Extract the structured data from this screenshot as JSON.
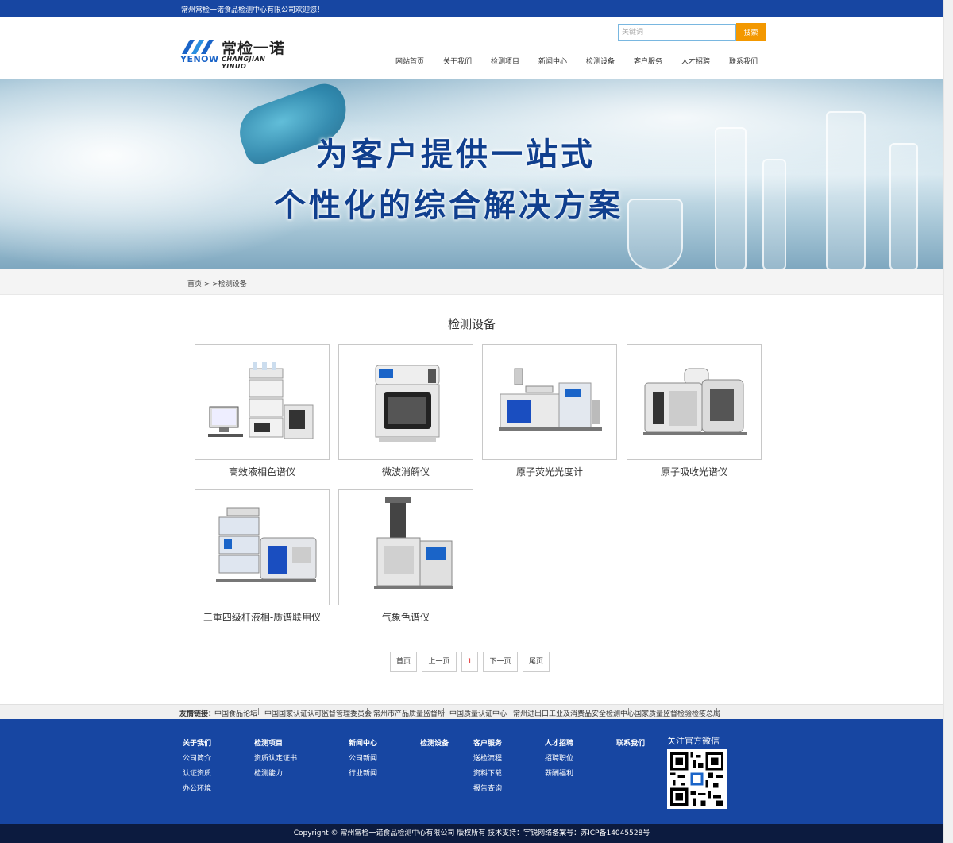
{
  "topbar": {
    "welcome": "常州常检一诺食品检测中心有限公司欢迎您！"
  },
  "logo": {
    "brand_en": "YENOW",
    "brand_cn": "常检一诺",
    "brand_pinyin": "CHANGJIAN YINUO"
  },
  "search": {
    "placeholder": "关键词",
    "button": "搜索"
  },
  "nav": [
    {
      "label": "网站首页"
    },
    {
      "label": "关于我们"
    },
    {
      "label": "检测项目"
    },
    {
      "label": "新闻中心"
    },
    {
      "label": "检测设备"
    },
    {
      "label": "客户服务"
    },
    {
      "label": "人才招聘"
    },
    {
      "label": "联系我们"
    }
  ],
  "banner": {
    "line1": "为客户提供一站式",
    "line2": "个性化的综合解决方案"
  },
  "breadcrumb": "首页 > >检测设备",
  "section_title": "检测设备",
  "products": [
    {
      "name": "高效液相色谱仪",
      "icon": "hplc-instrument-image"
    },
    {
      "name": "微波消解仪",
      "icon": "microwave-digester-image"
    },
    {
      "name": "原子荧光光度计",
      "icon": "atomic-fluorescence-image"
    },
    {
      "name": "原子吸收光谱仪",
      "icon": "atomic-absorption-image"
    },
    {
      "name": "三重四级杆液相-质谱联用仪",
      "icon": "lc-ms-image"
    },
    {
      "name": "气象色谱仪",
      "icon": "gas-chromatograph-image"
    }
  ],
  "pagination": {
    "first": "首页",
    "prev": "上一页",
    "current": "1",
    "next": "下一页",
    "last": "尾页"
  },
  "friend_links": {
    "label": "友情链接：",
    "items": [
      "中国食品论坛",
      "中国国家认证认可监督管理委员会",
      "常州市产品质量监督所",
      "中国质量认证中心",
      "常州进出口工业及消费品安全检测中心",
      "国家质量监督检验检疫总局"
    ]
  },
  "footer": {
    "columns": [
      {
        "title": "关于我们",
        "items": [
          "公司简介",
          "认证资质",
          "办公环境"
        ]
      },
      {
        "title": "检测项目",
        "items": [
          "资质认定证书",
          "检测能力"
        ]
      },
      {
        "title": "新闻中心",
        "items": [
          "公司新闻",
          "行业新闻"
        ]
      },
      {
        "title": "检测设备",
        "items": []
      },
      {
        "title": "客户服务",
        "items": [
          "送检流程",
          "资料下载",
          "报告查询"
        ]
      },
      {
        "title": "人才招聘",
        "items": [
          "招聘职位",
          "薪酬福利"
        ]
      },
      {
        "title": "联系我们",
        "items": []
      }
    ],
    "wechat_title": "关注官方微信"
  },
  "copyright": "Copyright © 常州常检一诺食品检测中心有限公司 版权所有 技术支持：宇锐网络备案号：苏ICP备14045528号",
  "colors": {
    "primary_blue": "#1746a2",
    "search_orange": "#f39800",
    "dark_footer": "#0c1b3f",
    "current_page_red": "#e02020"
  }
}
